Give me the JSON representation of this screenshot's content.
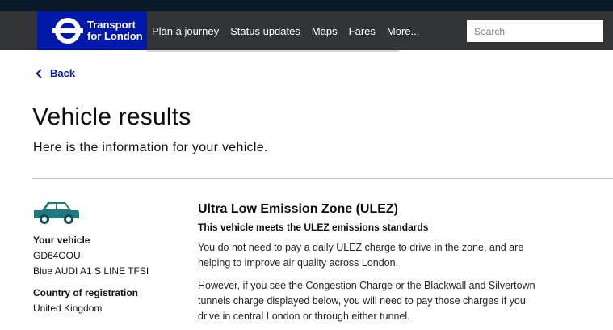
{
  "header": {
    "logo_line1": "Transport",
    "logo_line2": "for London",
    "nav": [
      "Plan a journey",
      "Status updates",
      "Maps",
      "Fares",
      "More..."
    ],
    "search_placeholder": "Search"
  },
  "back_label": "Back",
  "page_title": "Vehicle results",
  "intro": "Here is the information for your vehicle.",
  "vehicle": {
    "icon": "car-icon",
    "label": "Your vehicle",
    "registration": "GD64OOU",
    "description": "Blue AUDI A1 S LINE TFSI",
    "country_label": "Country of registration",
    "country": "United Kingdom"
  },
  "result": {
    "heading": "Ultra Low Emission Zone (ULEZ)",
    "status": "This vehicle meets the ULEZ emissions standards",
    "para1": "You do not need to pay a daily ULEZ charge to drive in the zone, and are helping to improve air quality across London.",
    "para2": "However, if you see the Congestion Charge or the Blackwall and Silvertown tunnels charge displayed below, you will need to pay those charges if you drive in central London or through either tunnel."
  },
  "colors": {
    "brand": "#0019a8",
    "header_bg": "#323436",
    "car": "#1f7a80"
  }
}
